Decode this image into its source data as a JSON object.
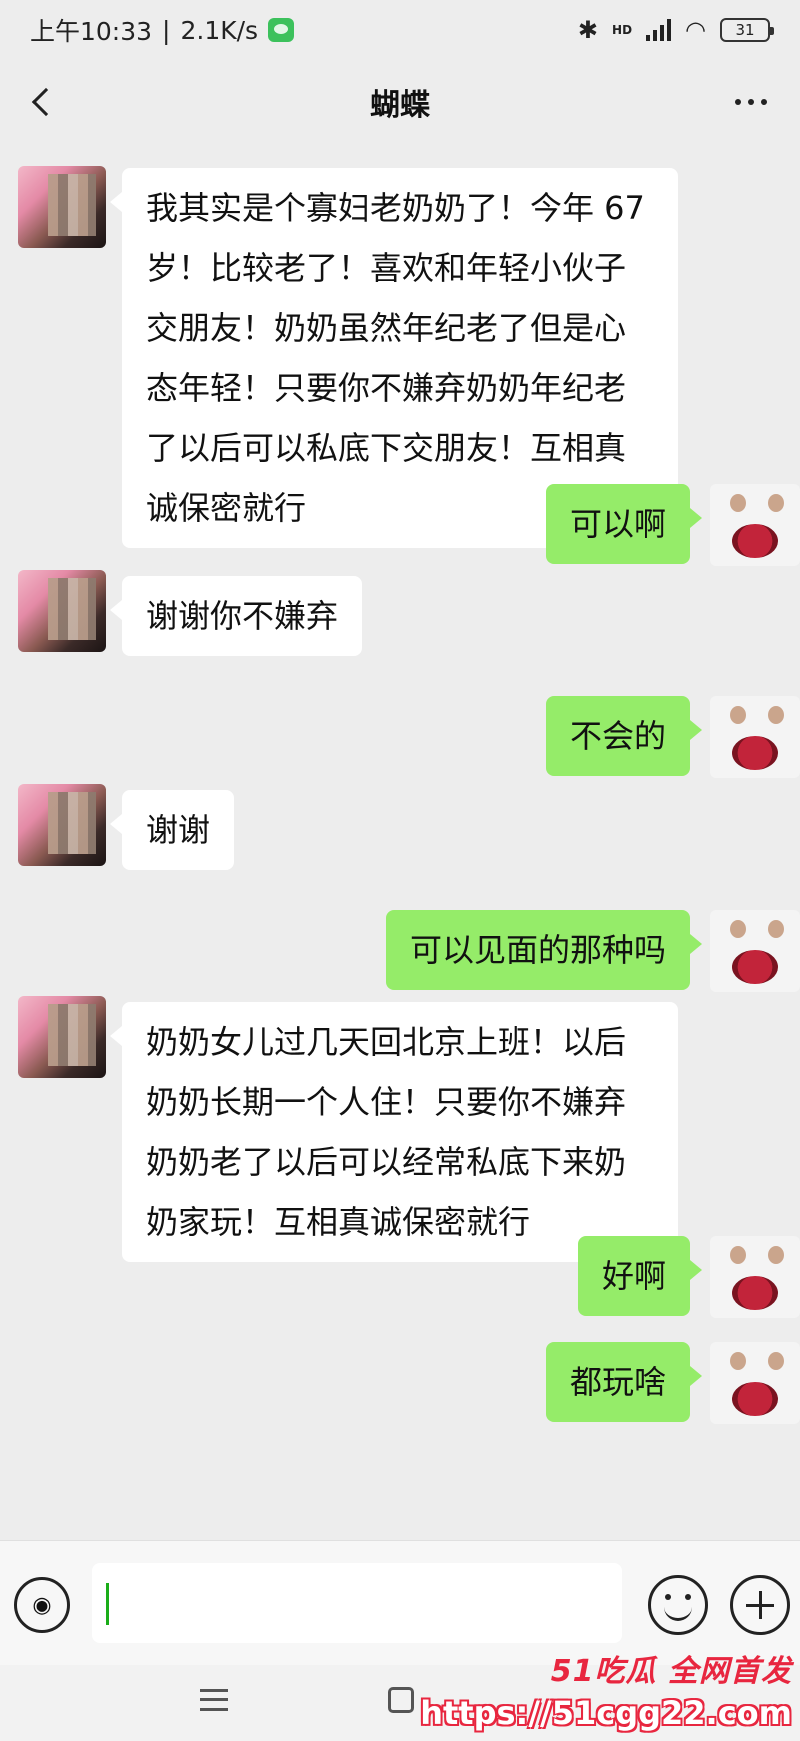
{
  "status_bar": {
    "time": "上午10:33",
    "speed": "2.1K/s",
    "network_label": "HD",
    "battery": "31"
  },
  "header": {
    "title": "蝴蝶"
  },
  "messages": [
    {
      "side": "in",
      "text": "我其实是个寡妇老奶奶了！今年 67 岁！比较老了！喜欢和年轻小伙子交朋友！奶奶虽然年纪老了但是心态年轻！只要你不嫌弃奶奶年纪老了以后可以私底下交朋友！互相真诚保密就行"
    },
    {
      "side": "out",
      "text": "可以啊"
    },
    {
      "side": "in",
      "text": "谢谢你不嫌弃"
    },
    {
      "side": "out",
      "text": "不会的"
    },
    {
      "side": "in",
      "text": "谢谢"
    },
    {
      "side": "out",
      "text": "可以见面的那种吗"
    },
    {
      "side": "in",
      "text": "奶奶女儿过几天回北京上班！以后奶奶长期一个人住！只要你不嫌弃奶奶老了以后可以经常私底下来奶奶家玩！互相真诚保密就行"
    },
    {
      "side": "out",
      "text": "好啊"
    },
    {
      "side": "out",
      "text": "都玩啥"
    }
  ],
  "input": {
    "value": ""
  },
  "watermark": {
    "brand": "51吃瓜 全网首发",
    "url": "https://51cgg22.com"
  }
}
